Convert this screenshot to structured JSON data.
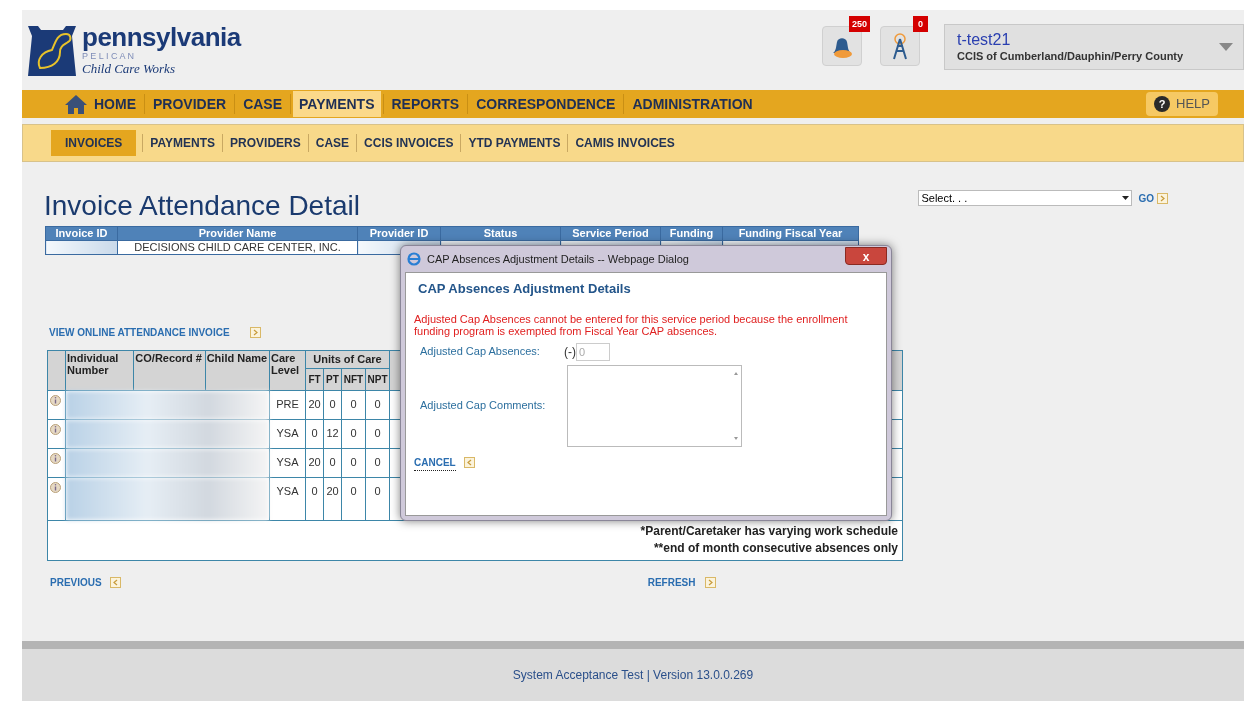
{
  "logo": {
    "name": "pennsylvania",
    "sub": "P E L I C A N",
    "tagline": "Child Care Works"
  },
  "notifications": [
    {
      "kind": "bell",
      "count": "250"
    },
    {
      "kind": "tower",
      "count": "0"
    }
  ],
  "user": {
    "name": "t-test21",
    "org": "CCIS of Cumberland/Dauphin/Perry County"
  },
  "main_nav": [
    {
      "label": "HOME",
      "selected": false
    },
    {
      "label": "PROVIDER",
      "selected": false
    },
    {
      "label": "CASE",
      "selected": false
    },
    {
      "label": "PAYMENTS",
      "selected": true
    },
    {
      "label": "REPORTS",
      "selected": false
    },
    {
      "label": "CORRESPONDENCE",
      "selected": false
    },
    {
      "label": "ADMINISTRATION",
      "selected": false
    }
  ],
  "help": {
    "icon": "?",
    "label": "HELP"
  },
  "sub_nav": [
    {
      "label": "INVOICES",
      "selected": true
    },
    {
      "label": "PAYMENTS",
      "selected": false
    },
    {
      "label": "PROVIDERS",
      "selected": false
    },
    {
      "label": "CASE",
      "selected": false
    },
    {
      "label": "CCIS INVOICES",
      "selected": false
    },
    {
      "label": "YTD PAYMENTS",
      "selected": false
    },
    {
      "label": "CAMIS INVOICES",
      "selected": false
    }
  ],
  "page_title": "Invoice Attendance Detail",
  "jump_select": {
    "value": "Select. . .",
    "go": "GO"
  },
  "summary_table": {
    "columns": [
      "Invoice ID",
      "Provider Name",
      "Provider ID",
      "Status",
      "Service Period",
      "Funding",
      "Funding Fiscal Year"
    ],
    "provider_name": "DECISIONS CHILD CARE CENTER, INC."
  },
  "view_link": "VIEW ONLINE ATTENDANCE INVOICE",
  "attendance_table": {
    "columns": [
      "Individual Number",
      "CO/Record #",
      "Child Name",
      "Care Level"
    ],
    "group": "Units of Care",
    "units": [
      "FT",
      "PT",
      "NFT",
      "NPT"
    ],
    "rows": [
      {
        "care_level": "PRE",
        "units": [
          "20",
          "0",
          "0",
          "0"
        ]
      },
      {
        "care_level": "YSA",
        "units": [
          "0",
          "12",
          "0",
          "0"
        ]
      },
      {
        "care_level": "YSA",
        "units": [
          "20",
          "0",
          "0",
          "0"
        ]
      },
      {
        "care_level": "YSA",
        "units": [
          "0",
          "20",
          "0",
          "0"
        ]
      }
    ],
    "footnotes": [
      "*Parent/Caretaker has varying work schedule",
      "**end of month consecutive absences only"
    ]
  },
  "previous": "PREVIOUS",
  "refresh": "REFRESH",
  "footer": "System Acceptance Test | Version 13.0.0.269",
  "dialog": {
    "title": "CAP Absences Adjustment Details -- Webpage Dialog",
    "close": "x",
    "heading": "CAP Absences Adjustment Details",
    "message": "Adjusted Cap Absences cannot be entered for this service period because the enrollment funding program is exempted from Fiscal Year CAP absences.",
    "absences_label": "Adjusted Cap Absences:",
    "absences_prefix": "(-)",
    "absences_value": "0",
    "absences_disabled": true,
    "comments_label": "Adjusted Cap Comments:",
    "cancel": "CANCEL"
  }
}
